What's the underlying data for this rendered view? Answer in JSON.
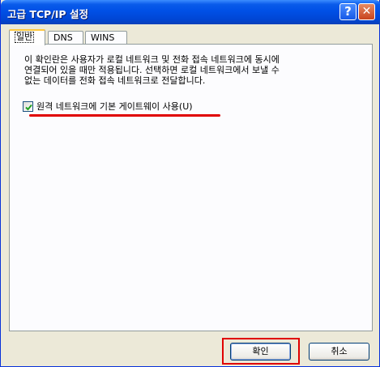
{
  "window": {
    "title": "고급 TCP/IP 설정",
    "help_button": "?",
    "close_button": "✕"
  },
  "tabs": [
    {
      "label": "일반",
      "active": true
    },
    {
      "label": "DNS",
      "active": false
    },
    {
      "label": "WINS",
      "active": false
    }
  ],
  "general": {
    "description": "이 확인란은 사용자가 로컬 네트워크 및 전화 접속 네트워크에 동시에\n연결되어 있을 때만 적용됩니다. 선택하면 로컬 네트워크에서 보낼 수\n없는 데이터를 전화 접속 네트워크로 전달합니다.",
    "checkbox_label": "원격 네트워크에 기본 게이트웨이 사용(U)",
    "checkbox_checked": true
  },
  "buttons": {
    "ok": "확인",
    "cancel": "취소"
  },
  "colors": {
    "annotation": "#e00000",
    "title_bar": "#0050e6",
    "dialog_bg": "#ece9d8"
  }
}
